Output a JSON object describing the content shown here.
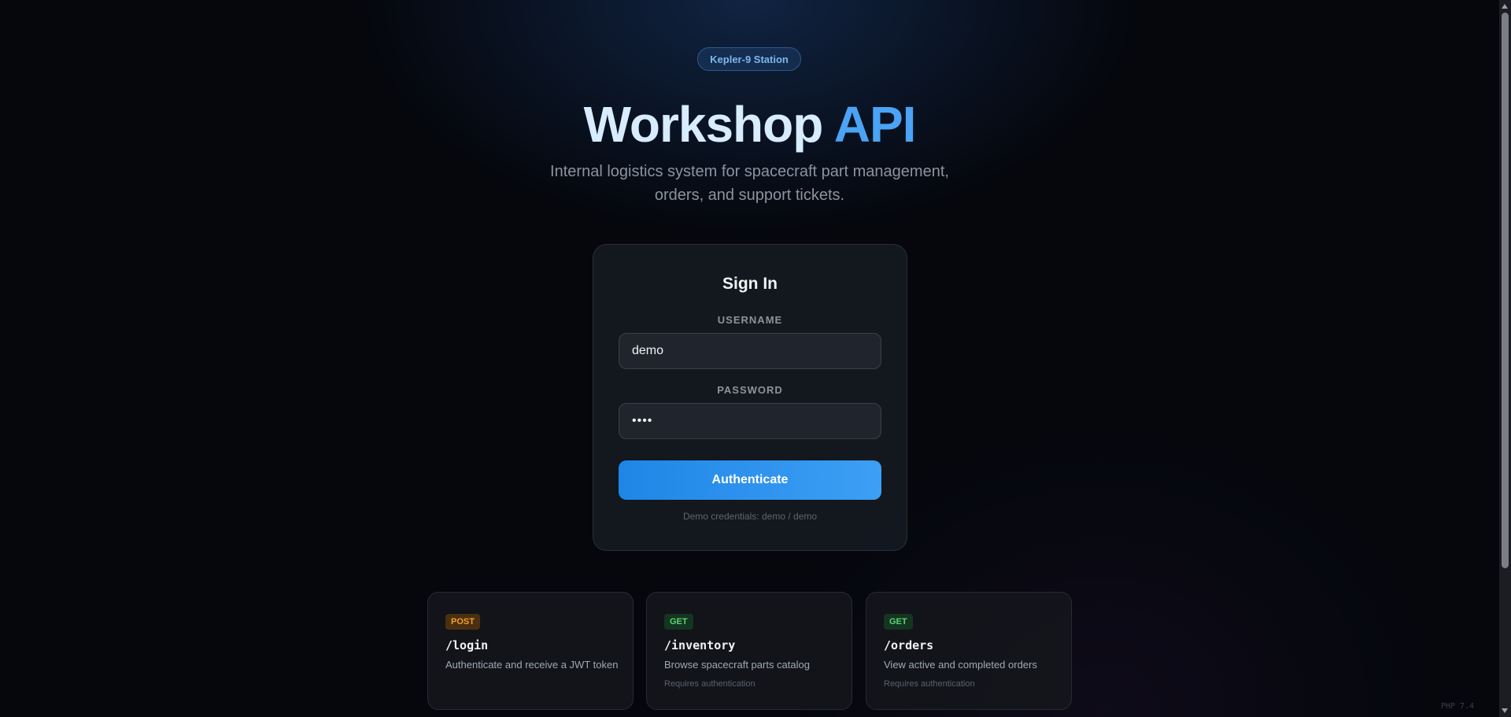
{
  "header": {
    "badge": "Kepler-9 Station",
    "title_part1": "Workshop",
    "title_part2": "API",
    "subtitle_line1": "Internal logistics system for spacecraft part management,",
    "subtitle_line2": "orders, and support tickets."
  },
  "login": {
    "title": "Sign In",
    "username_label": "USERNAME",
    "username_value": "demo",
    "password_label": "PASSWORD",
    "password_value": "••••",
    "submit_label": "Authenticate",
    "hint": "Demo credentials: demo / demo"
  },
  "endpoints": [
    {
      "method": "POST",
      "path": "/login",
      "description": "Authenticate and receive a JWT token",
      "note": ""
    },
    {
      "method": "GET",
      "path": "/inventory",
      "description": "Browse spacecraft parts catalog",
      "note": "Requires authentication"
    },
    {
      "method": "GET",
      "path": "/orders",
      "description": "View active and completed orders",
      "note": "Requires authentication"
    }
  ],
  "footer": {
    "version": "PHP 7.4"
  },
  "colors": {
    "accent": "#3d9ff5",
    "post": "#f0a030",
    "get": "#5fd07a"
  }
}
